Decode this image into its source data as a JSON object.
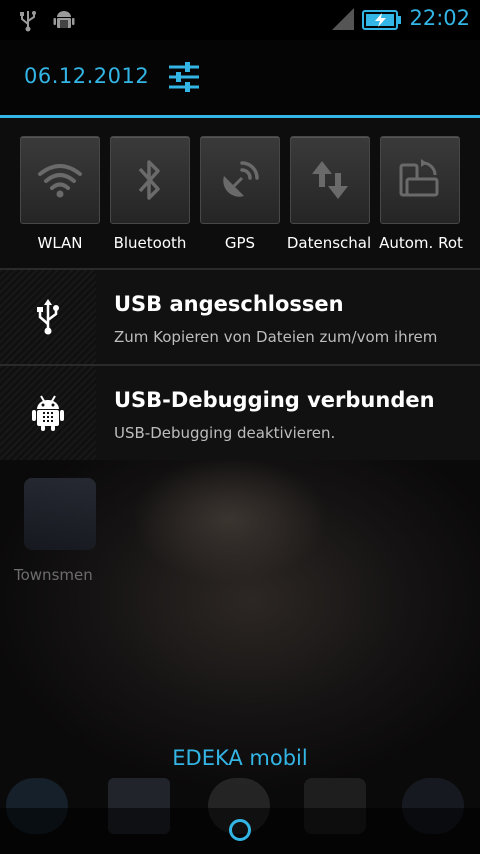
{
  "status_bar": {
    "time": "22:02",
    "icons": [
      "usb-icon",
      "android-debug-icon",
      "signal-icon",
      "battery-charging-icon"
    ]
  },
  "header": {
    "date": "06.12.2012",
    "settings_icon": "settings-sliders-icon"
  },
  "quick_settings": [
    {
      "label": "WLAN",
      "icon": "wifi-icon"
    },
    {
      "label": "Bluetooth",
      "icon": "bluetooth-icon"
    },
    {
      "label": "GPS",
      "icon": "gps-icon"
    },
    {
      "label": "Datenschal",
      "icon": "data-transfer-icon"
    },
    {
      "label": "Autom. Rot",
      "icon": "auto-rotate-icon"
    }
  ],
  "notifications": [
    {
      "title": "USB angeschlossen",
      "text": "Zum Kopieren von Dateien zum/vom ihrem",
      "icon": "usb-icon"
    },
    {
      "title": "USB-Debugging verbunden",
      "text": "USB-Debugging deaktivieren.",
      "icon": "android-debug-icon"
    }
  ],
  "background": {
    "app_label": "Townsmen",
    "carrier": "EDEKA mobil"
  },
  "colors": {
    "accent": "#33b5e5",
    "background": "#000000"
  }
}
